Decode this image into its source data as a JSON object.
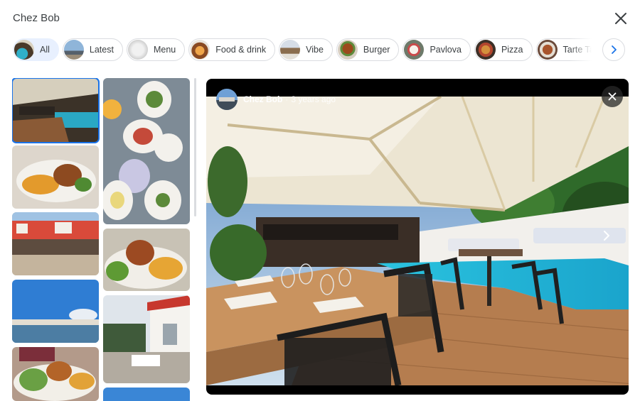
{
  "header": {
    "title": "Chez Bob"
  },
  "chips": [
    {
      "label": "All",
      "active": true
    },
    {
      "label": "Latest"
    },
    {
      "label": "Menu"
    },
    {
      "label": "Food & drink"
    },
    {
      "label": "Vibe"
    },
    {
      "label": "Burger"
    },
    {
      "label": "Pavlova"
    },
    {
      "label": "Pizza"
    },
    {
      "label": "Tarte Tatin"
    }
  ],
  "viewer": {
    "author": "Chez Bob",
    "separator": "·",
    "age": "3 years ago"
  },
  "colors": {
    "accent": "#1a73e8",
    "chip_active_bg": "#e8f0fe",
    "pool": "#20b3d6",
    "deck": "#b07a4e",
    "awning": "#ede6d3"
  },
  "icons": {
    "close": "close-icon",
    "next": "chevron-right-icon"
  }
}
